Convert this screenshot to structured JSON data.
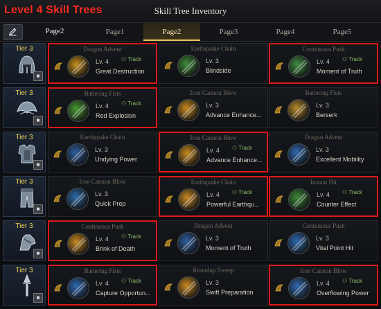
{
  "overlay_title": "Level 4 Skill Trees",
  "window_title": "Skill Tree Inventory",
  "current_page": "Page2",
  "tabs": [
    "Page1",
    "Page2",
    "Page3",
    "Page4",
    "Page5"
  ],
  "active_tab": 1,
  "rows": [
    {
      "tier": "Tier 3",
      "equip": "helmet",
      "cells": [
        {
          "skill": "Dragon Advent",
          "level": "Lv. 4",
          "tripod": "Great Destruction",
          "track": "Track",
          "highlight": true,
          "orb": "#c7901c"
        },
        {
          "skill": "Earthquake Chain",
          "level": "Lv. 3",
          "tripod": "Blindside",
          "track": "",
          "highlight": false,
          "orb": "#3e8a3a"
        },
        {
          "skill": "Continuous Push",
          "level": "Lv. 4",
          "tripod": "Moment of Truth",
          "track": "Track",
          "highlight": true,
          "orb": "#3f8c44"
        }
      ]
    },
    {
      "tier": "Tier 3",
      "equip": "shoulders",
      "cells": [
        {
          "skill": "Battering Fists",
          "level": "Lv. 4",
          "tripod": "Red Explosion",
          "track": "Track",
          "highlight": true,
          "orb": "#4a9a34"
        },
        {
          "skill": "Iron Cannon Blow",
          "level": "Lv. 3",
          "tripod": "Advance Enhance...",
          "track": "",
          "highlight": false,
          "orb": "#c98a22"
        },
        {
          "skill": "Battering Fists",
          "level": "Lv. 3",
          "tripod": "Berserk",
          "track": "",
          "highlight": false,
          "orb": "#b88a2c"
        }
      ]
    },
    {
      "tier": "Tier 3",
      "equip": "chest",
      "cells": [
        {
          "skill": "Earthquake Chain",
          "level": "Lv. 3",
          "tripod": "Undying Power",
          "track": "",
          "highlight": false,
          "orb": "#2f5fa0"
        },
        {
          "skill": "Iron Cannon Blow",
          "level": "Lv. 4",
          "tripod": "Advance Enhance...",
          "track": "Track",
          "highlight": true,
          "orb": "#c98a22"
        },
        {
          "skill": "Dragon Advent",
          "level": "Lv. 3",
          "tripod": "Excellent Mobility",
          "track": "",
          "highlight": false,
          "orb": "#2f6ab0"
        }
      ]
    },
    {
      "tier": "Tier 3",
      "equip": "pants",
      "cells": [
        {
          "skill": "Iron Cannon Blow",
          "level": "Lv. 3",
          "tripod": "Quick Prep",
          "track": "",
          "highlight": false,
          "orb": "#2d6aa8"
        },
        {
          "skill": "Earthquake Chain",
          "level": "Lv. 4",
          "tripod": "Powerful Earthqu...",
          "track": "Track",
          "highlight": true,
          "orb": "#c98a22"
        },
        {
          "skill": "Instant Hit",
          "level": "Lv. 4",
          "tripod": "Counter Effect",
          "track": "Track",
          "highlight": true,
          "orb": "#3e8a3a"
        }
      ]
    },
    {
      "tier": "Tier 3",
      "equip": "gloves",
      "cells": [
        {
          "skill": "Continuous Push",
          "level": "Lv. 4",
          "tripod": "Brink of Death",
          "track": "Track",
          "highlight": true,
          "orb": "#c98a22"
        },
        {
          "skill": "Dragon Advent",
          "level": "Lv. 3",
          "tripod": "Moment of Truth",
          "track": "",
          "highlight": false,
          "orb": "#2f5fa0"
        },
        {
          "skill": "Continuous Push",
          "level": "Lv. 3",
          "tripod": "Vital Point Hit",
          "track": "",
          "highlight": false,
          "orb": "#2f6ab0"
        }
      ]
    },
    {
      "tier": "Tier 3",
      "equip": "weapon",
      "cells": [
        {
          "skill": "Battering Fists",
          "level": "Lv. 4",
          "tripod": "Capture Opportun...",
          "track": "Track",
          "highlight": true,
          "orb": "#2f6ab0"
        },
        {
          "skill": "Roundup Sweep",
          "level": "Lv. 3",
          "tripod": "Swift Preparation",
          "track": "",
          "highlight": false,
          "orb": "#c98a22"
        },
        {
          "skill": "Iron Cannon Blow",
          "level": "Lv. 4",
          "tripod": "Overflowing Power",
          "track": "Track",
          "highlight": true,
          "orb": "#2f6ab0"
        }
      ]
    }
  ]
}
